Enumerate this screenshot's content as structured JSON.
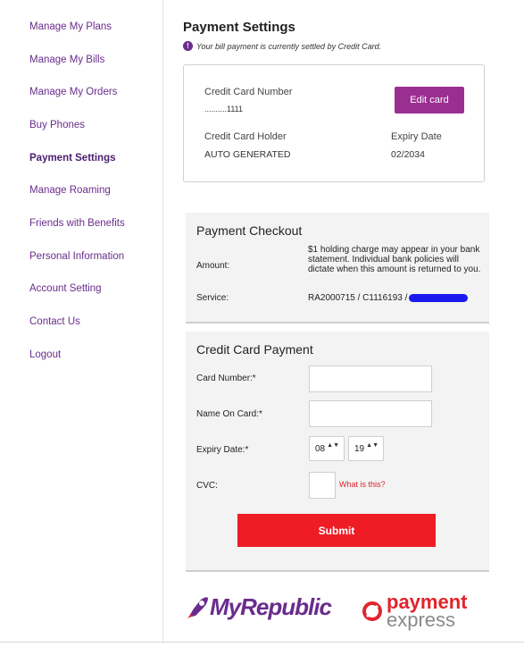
{
  "sidebar": {
    "items": [
      {
        "label": "Manage My Plans",
        "active": false
      },
      {
        "label": "Manage My Bills",
        "active": false
      },
      {
        "label": "Manage My Orders",
        "active": false
      },
      {
        "label": "Buy Phones",
        "active": false
      },
      {
        "label": "Payment Settings",
        "active": true
      },
      {
        "label": "Manage Roaming",
        "active": false
      },
      {
        "label": "Friends with Benefits",
        "active": false
      },
      {
        "label": "Personal Information",
        "active": false
      },
      {
        "label": "Account Setting",
        "active": false
      },
      {
        "label": "Contact Us",
        "active": false
      },
      {
        "label": "Logout",
        "active": false
      }
    ]
  },
  "main": {
    "title": "Payment Settings",
    "notice": "Your bill payment is currently settled by Credit Card.",
    "notice_icon": "info-icon",
    "card": {
      "number_label": "Credit Card Number",
      "number_value": "..........1111",
      "holder_label": "Credit Card Holder",
      "holder_value": "AUTO GENERATED",
      "expiry_label": "Expiry Date",
      "expiry_value": "02/2034",
      "edit_label": "Edit card"
    }
  },
  "checkout": {
    "title": "Payment Checkout",
    "amount_label": "Amount:",
    "amount_value": "$1 holding charge may appear in your bank statement. Individual bank policies will dictate when this amount is returned to you.",
    "service_label": "Service:",
    "service_value": "RA2000715 / C1116193 /"
  },
  "cc_form": {
    "title": "Credit Card Payment",
    "card_number_label": "Card Number:*",
    "name_label": "Name On Card:*",
    "expiry_label": "Expiry Date:*",
    "expiry_month": "08",
    "expiry_year": "19",
    "cvc_label": "CVC:",
    "cvc_help": "What is this?",
    "submit_label": "Submit"
  },
  "logos": {
    "myrepublic": "MyRepublic",
    "payment_top": "payment",
    "payment_bottom": "express"
  },
  "colors": {
    "brand_purple": "#6a2c8d",
    "edit_button": "#9b2f91",
    "submit_red": "#ee1c25"
  }
}
